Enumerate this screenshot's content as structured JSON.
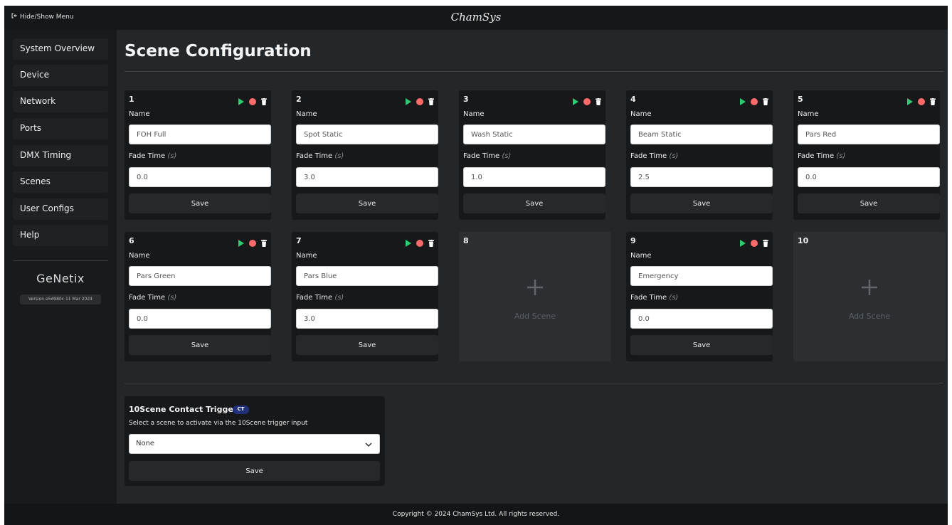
{
  "topbar": {
    "menu_toggle": "Hide/Show Menu",
    "brand": "ChamSys"
  },
  "sidebar": {
    "items": [
      {
        "label": "System Overview"
      },
      {
        "label": "Device"
      },
      {
        "label": "Network"
      },
      {
        "label": "Ports"
      },
      {
        "label": "DMX Timing"
      },
      {
        "label": "Scenes"
      },
      {
        "label": "User Configs"
      },
      {
        "label": "Help"
      }
    ],
    "logo": "GeNetix",
    "version": "Version e5d980c 11 Mar 2024"
  },
  "page": {
    "title": "Scene Configuration"
  },
  "field_labels": {
    "name": "Name",
    "fade_time": "Fade Time",
    "fade_unit": "(s)",
    "save": "Save"
  },
  "scenes": [
    {
      "number": "1",
      "name": "FOH Full",
      "fade": "0.0"
    },
    {
      "number": "2",
      "name": "Spot Static",
      "fade": "3.0"
    },
    {
      "number": "3",
      "name": "Wash Static",
      "fade": "1.0"
    },
    {
      "number": "4",
      "name": "Beam Static",
      "fade": "2.5"
    },
    {
      "number": "5",
      "name": "Pars Red",
      "fade": "0.0"
    },
    {
      "number": "6",
      "name": "Pars Green",
      "fade": "0.0"
    },
    {
      "number": "7",
      "name": "Pars Blue",
      "fade": "3.0"
    },
    {
      "number": "8",
      "empty": true,
      "add_label": "Add Scene"
    },
    {
      "number": "9",
      "name": "Emergency",
      "fade": "0.0"
    },
    {
      "number": "10",
      "empty": true,
      "add_label": "Add Scene"
    }
  ],
  "trigger": {
    "title": "10Scene Contact Trigger",
    "badge": "CT",
    "description": "Select a scene to activate via the 10Scene trigger input",
    "selected": "None",
    "save": "Save"
  },
  "footer": {
    "text": "Copyright © 2024 ChamSys Ltd.  All rights reserved."
  },
  "colors": {
    "play": "#2ecc71",
    "record": "#ff6b6b",
    "trash": "#ffffff",
    "badge": "#21307a"
  }
}
